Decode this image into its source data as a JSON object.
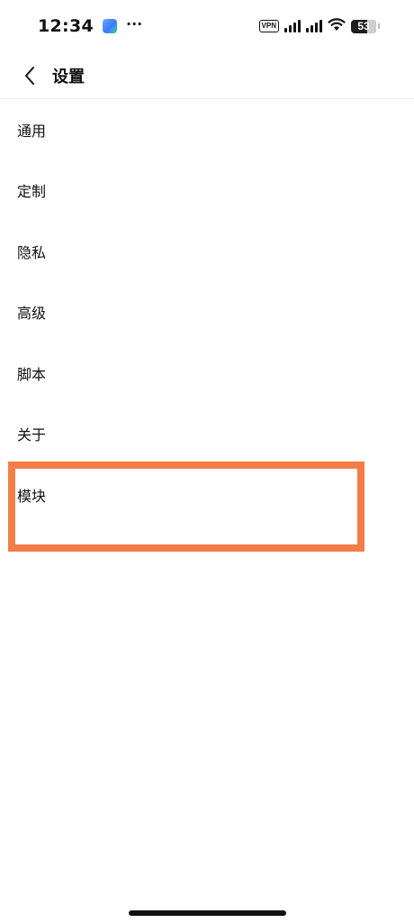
{
  "status_bar": {
    "time": "12:34",
    "more": "···",
    "vpn": "VPN",
    "battery": "53"
  },
  "header": {
    "title": "设置",
    "back_icon": "chevron-left-icon"
  },
  "settings_items": [
    {
      "label": "通用"
    },
    {
      "label": "定制"
    },
    {
      "label": "隐私"
    },
    {
      "label": "高级"
    },
    {
      "label": "脚本"
    },
    {
      "label": "关于"
    },
    {
      "label": "模块"
    }
  ],
  "colors": {
    "highlight": "#f47c46",
    "text": "#111111",
    "divider": "#ececec"
  }
}
